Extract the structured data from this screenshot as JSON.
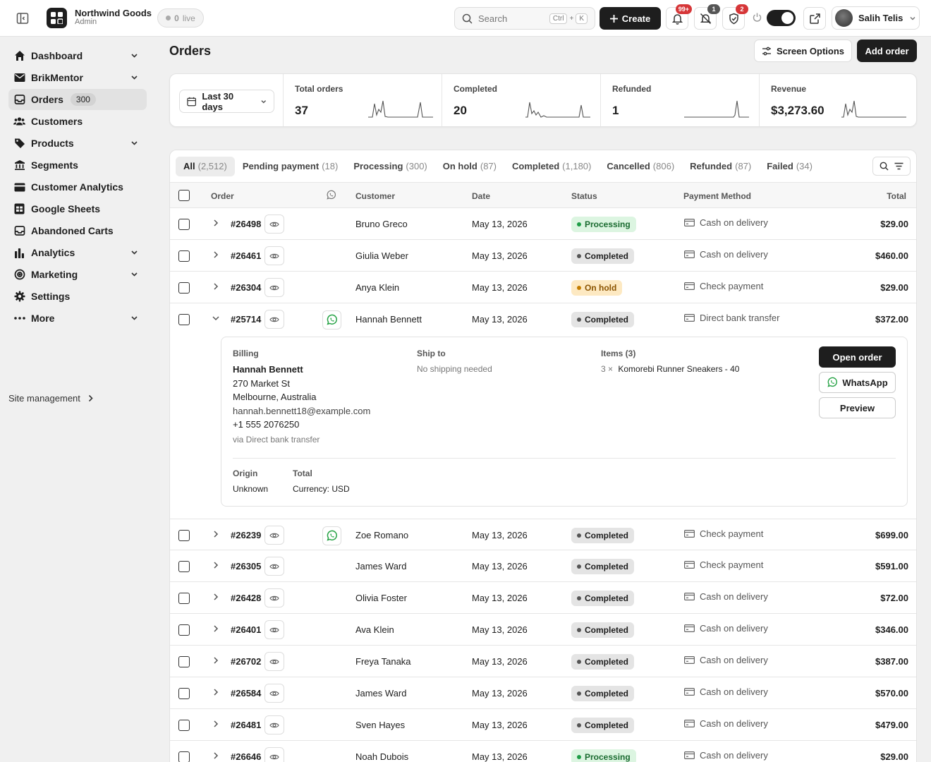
{
  "topbar": {
    "brand_name": "Northwind Goods",
    "brand_role": "Admin",
    "live_count": "0",
    "live_label": "live",
    "search_placeholder": "Search",
    "search_kbd_1": "Ctrl",
    "search_kbd_plus": "+",
    "search_kbd_2": "K",
    "create_label": "Create",
    "notifications_badge": "99+",
    "alerts_badge": "1",
    "security_badge": "2",
    "user_name": "Salih Telis"
  },
  "sidebar": {
    "items": [
      {
        "label": "Dashboard",
        "icon": "home-icon"
      },
      {
        "label": "BrikMentor",
        "icon": "mail-icon"
      },
      {
        "label": "Orders",
        "icon": "inbox-icon",
        "count": "300"
      },
      {
        "label": "Customers",
        "icon": "users-icon"
      },
      {
        "label": "Products",
        "icon": "tag-icon"
      },
      {
        "label": "Segments",
        "icon": "bank-icon"
      },
      {
        "label": "Customer Analytics",
        "icon": "card-icon"
      },
      {
        "label": "Google Sheets",
        "icon": "sheet-icon"
      },
      {
        "label": "Abandoned Carts",
        "icon": "inbox-icon"
      },
      {
        "label": "Analytics",
        "icon": "bar-chart-icon"
      },
      {
        "label": "Marketing",
        "icon": "target-icon"
      },
      {
        "label": "Settings",
        "icon": "gear-icon"
      },
      {
        "label": "More",
        "icon": "dots-icon"
      }
    ],
    "site_management": "Site management"
  },
  "page": {
    "title": "Orders",
    "screen_options": "Screen Options",
    "add_order": "Add order"
  },
  "stats": {
    "range": "Last 30 days",
    "cards": [
      {
        "label": "Total orders",
        "value": "37"
      },
      {
        "label": "Completed",
        "value": "20"
      },
      {
        "label": "Refunded",
        "value": "1"
      },
      {
        "label": "Revenue",
        "value": "$3,273.60"
      }
    ]
  },
  "tabs": [
    {
      "label": "All",
      "count": "(2,512)"
    },
    {
      "label": "Pending payment",
      "count": "(18)"
    },
    {
      "label": "Processing",
      "count": "(300)"
    },
    {
      "label": "On hold",
      "count": "(87)"
    },
    {
      "label": "Completed",
      "count": "(1,180)"
    },
    {
      "label": "Cancelled",
      "count": "(806)"
    },
    {
      "label": "Refunded",
      "count": "(87)"
    },
    {
      "label": "Failed",
      "count": "(34)"
    }
  ],
  "columns": {
    "order": "Order",
    "customer": "Customer",
    "date": "Date",
    "status": "Status",
    "payment": "Payment Method",
    "total": "Total"
  },
  "rows_top": [
    {
      "order": "#26498",
      "customer": "Bruno Greco",
      "date": "May 13, 2026",
      "status": "Processing",
      "payment": "Cash on delivery",
      "total": "$29.00"
    },
    {
      "order": "#26461",
      "customer": "Giulia Weber",
      "date": "May 13, 2026",
      "status": "Completed",
      "payment": "Cash on delivery",
      "total": "$460.00"
    },
    {
      "order": "#26304",
      "customer": "Anya Klein",
      "date": "May 13, 2026",
      "status": "On hold",
      "payment": "Check payment",
      "total": "$29.00"
    },
    {
      "order": "#25714",
      "customer": "Hannah Bennett",
      "date": "May 13, 2026",
      "status": "Completed",
      "payment": "Direct bank transfer",
      "total": "$372.00"
    }
  ],
  "detail": {
    "billing_label": "Billing",
    "billing_name": "Hannah Bennett",
    "billing_street": "270 Market St",
    "billing_city": "Melbourne, Australia",
    "billing_email": "hannah.bennett18@example.com",
    "billing_phone": "+1 555 2076250",
    "billing_via": "via Direct bank transfer",
    "ship_label": "Ship to",
    "ship_value": "No shipping needed",
    "items_label": "Items (3)",
    "item_qty": "3 ×",
    "item_name": "Komorebi Runner Sneakers - 40",
    "origin_label": "Origin",
    "origin_value": "Unknown",
    "total_label": "Total",
    "total_value": "Currency: USD",
    "open_order": "Open order",
    "whatsapp": "WhatsApp",
    "preview": "Preview"
  },
  "rows_bottom": [
    {
      "order": "#26239",
      "customer": "Zoe Romano",
      "date": "May 13, 2026",
      "status": "Completed",
      "payment": "Check payment",
      "total": "$699.00"
    },
    {
      "order": "#26305",
      "customer": "James Ward",
      "date": "May 13, 2026",
      "status": "Completed",
      "payment": "Check payment",
      "total": "$591.00"
    },
    {
      "order": "#26428",
      "customer": "Olivia Foster",
      "date": "May 13, 2026",
      "status": "Completed",
      "payment": "Cash on delivery",
      "total": "$72.00"
    },
    {
      "order": "#26401",
      "customer": "Ava Klein",
      "date": "May 13, 2026",
      "status": "Completed",
      "payment": "Cash on delivery",
      "total": "$346.00"
    },
    {
      "order": "#26702",
      "customer": "Freya Tanaka",
      "date": "May 13, 2026",
      "status": "Completed",
      "payment": "Cash on delivery",
      "total": "$387.00"
    },
    {
      "order": "#26584",
      "customer": "James Ward",
      "date": "May 13, 2026",
      "status": "Completed",
      "payment": "Cash on delivery",
      "total": "$570.00"
    },
    {
      "order": "#26481",
      "customer": "Sven Hayes",
      "date": "May 13, 2026",
      "status": "Completed",
      "payment": "Cash on delivery",
      "total": "$479.00"
    },
    {
      "order": "#26646",
      "customer": "Noah Dubois",
      "date": "May 13, 2026",
      "status": "Processing",
      "payment": "Cash on delivery",
      "total": "$29.00"
    }
  ],
  "colors": {
    "primary": "#1e1e1e",
    "processing_bg": "#dcf5e1",
    "processing_text": "#1a6b30",
    "completed_bg": "#e4e4e4",
    "onhold_bg": "#fde9c2",
    "onhold_text": "#8a5300",
    "badge_red": "#d63638",
    "badge_gray": "#555555",
    "whatsapp_green": "#25a244"
  }
}
